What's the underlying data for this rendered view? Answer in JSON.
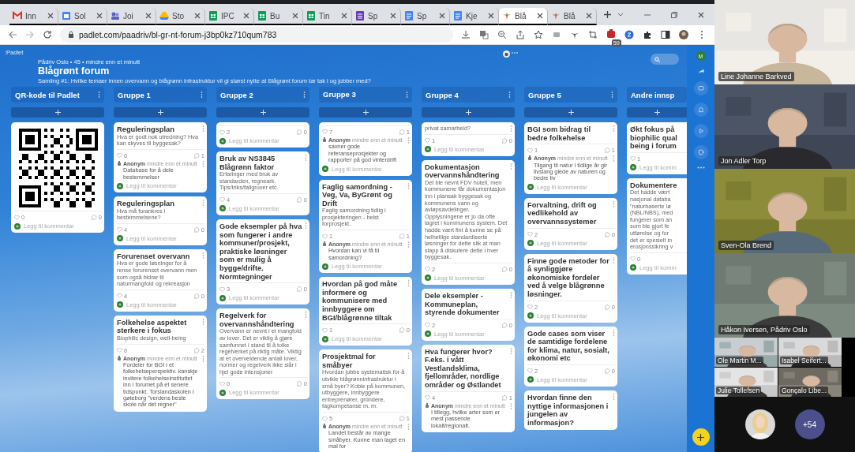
{
  "browser": {
    "tabs": [
      {
        "label": "Inn",
        "kind": "mail",
        "selected": false
      },
      {
        "label": "Sol",
        "kind": "calendar",
        "selected": false
      },
      {
        "label": "Joi",
        "kind": "teams",
        "selected": false
      },
      {
        "label": "Sto",
        "kind": "drive",
        "selected": false
      },
      {
        "label": "IPC",
        "kind": "sheet",
        "selected": false
      },
      {
        "label": "Bu",
        "kind": "sheet",
        "selected": false
      },
      {
        "label": "Tin",
        "kind": "sheet",
        "selected": false
      },
      {
        "label": "Sp",
        "kind": "form",
        "selected": false
      },
      {
        "label": "Sp",
        "kind": "doc",
        "selected": false
      },
      {
        "label": "Kje",
        "kind": "doc",
        "selected": false
      },
      {
        "label": "Blå",
        "kind": "padlet",
        "selected": true
      },
      {
        "label": "Blå",
        "kind": "padlet",
        "selected": false
      }
    ],
    "url": "padlet.com/paadriv/bl-gr-nt-forum-j3bp0kz710qum783",
    "extension_badge": "59"
  },
  "padlet": {
    "brand": ":Padlet",
    "meta": "Pådriv Oslo • 45 • mindre enn et minutt",
    "title": "Blågrønt forum",
    "subtitle": "Samling #1: Hvilke temaer innen overvann og blågrønn infrastruktur vil gi størst nytte at Blågrønt forum tar tak i og jobber med?",
    "user_initial": "M",
    "columns": [
      {
        "title": "QR-kode til Padlet",
        "cards": [
          {
            "kind": "qr",
            "likes": "0",
            "comments": "0",
            "placeholder": "Legg til kommentar"
          }
        ]
      },
      {
        "title": "Gruppe 1",
        "cards": [
          {
            "kind": "post",
            "title": "Reguleringsplan",
            "body": "Hva er godt nok utredning? Hva kan skyves til byggesak?",
            "likes": "6",
            "comments": "1",
            "comment": {
              "author": "Anonym",
              "time": "mindre enn et minutt",
              "text": "Database for å dele bestemmelser"
            },
            "placeholder": "Legg til kommentar"
          },
          {
            "kind": "post",
            "title": "Reguleringsplan",
            "body": "Hva må forankres i bestemmelsene?",
            "likes": "4",
            "comments": "0",
            "placeholder": "Legg til kommentar"
          },
          {
            "kind": "post",
            "title": "Forurenset overvann",
            "body": "Hva er gode løsninger for å rense forurenset overvann men som også bidrar til naturmangfold og rekreasjon",
            "likes": "4",
            "comments": "0",
            "placeholder": "Legg til kommentar"
          },
          {
            "kind": "post",
            "title": "Folkehelse aspektet sterkere i fokus",
            "body": "Biophilic design, well-being",
            "likes": "6",
            "comments": "2",
            "comment": {
              "author": "Anonym",
              "time": "mindre enn et minutt",
              "text": "Fordeler for BGI i et folkehelseperspektiv. kanskje invitere folkehelseinstituttet inn i forumet på et senere tidspunkt. Torslandaskolen i gøteborg \"verdens beste skole når det regner\""
            }
          }
        ]
      },
      {
        "title": "Gruppe 2",
        "cards": [
          {
            "kind": "post",
            "likes": "2",
            "comments": "0",
            "placeholder": "Legg til kommentar"
          },
          {
            "kind": "post",
            "title": "Bruk av NS3845 Blågrønn faktor",
            "body": "Erfaringer med bruk av standarden, regneark. Tips/triks/fallgruver etc.",
            "likes": "4",
            "comments": "0",
            "placeholder": "Legg til kommentar"
          },
          {
            "kind": "post",
            "title": "Gode eksempler på hva som fungerer i andre kommuner/prosjekt, praktiske løsninger som er mulig å bygge/drifte. Normtegninger",
            "likes": "3",
            "comments": "0",
            "placeholder": "Legg til kommentar"
          },
          {
            "kind": "post",
            "title": "Regelverk for overvannshåndtering",
            "body": "Overvann er nevnt i et mangfold av lover. Det er viktig å gjøre samfunnet i stand til å tolke regelverket på riktig måte. Viktig at et overveldende antall lover, normer og regelverk ikke slår i hjel gode intensjoner",
            "likes": "0",
            "comments": "0",
            "placeholder": "Legg til kommentar"
          }
        ]
      },
      {
        "title": "Gruppe 3",
        "cards": [
          {
            "kind": "post",
            "likes": "7",
            "comments": "1",
            "comment": {
              "author": "Anonym",
              "time": "mindre enn et minutt",
              "text": "savner gode referanseprosjekter og rapporter på god vinterdrift"
            },
            "placeholder": "Legg til kommentar"
          },
          {
            "kind": "post",
            "title": "Faglig samordning - Veg, Va, ByGrønt og Drift",
            "body": "Faglig samordning tidlig i prosjekteringen - helst forprosjekt.",
            "likes": "1",
            "comments": "1",
            "comment": {
              "author": "Anonym",
              "time": "mindre enn et minutt",
              "text": "Hvordan kan vi få til samordning?"
            },
            "placeholder": "Legg til kommentar"
          },
          {
            "kind": "post",
            "title": "Hvordan på god måte informere og kommunisere med innbyggere om BGI/blågrønne tiltak",
            "likes": "1",
            "comments": "0",
            "placeholder": "Legg til kommentar"
          },
          {
            "kind": "post",
            "title": "Prosjektmal for småbyer",
            "body": "Hvordan jobbe systematisk for å utvikle blågrønninfrastruktur i små byer? Koble på kommunen, utbyggere, innbyggere entreprenører, gründere, fagkompetanse m. m.",
            "likes": "5",
            "comments": "1",
            "comment": {
              "author": "Anonym",
              "time": "mindre enn et minutt",
              "text": "Landet består av mange småbyer. Kunne man laget en mal for"
            }
          }
        ]
      },
      {
        "title": "Gruppe 4",
        "cards": [
          {
            "kind": "post",
            "body": "privat samarbeid?",
            "likes": "1",
            "comments": "0",
            "placeholder": "Legg til kommentar"
          },
          {
            "kind": "post",
            "title": "Dokumentasjon overvannshåndtering",
            "body": "Det ble nevnt FDV hotell, men kommunene får dokumentasjon inn i plansak byggesak og kommunens vann og avløpsavdelinger. Opplysningene er jo da ofte lagret i kommunens system. Det hadde vært fint å kunne se på helhetlige standardiserte løsninger for dette slik at man slapp å diskutere dette i hver byggesak.",
            "likes": "2",
            "comments": "0",
            "placeholder": "Legg til kommentar"
          },
          {
            "kind": "post",
            "title": "Dele eksempler - Kommuneplan, styrende dokumenter",
            "likes": "2",
            "comments": "0",
            "placeholder": "Legg til kommentar"
          },
          {
            "kind": "post",
            "title": "Hva fungerer hvor? F.eks. i vått Vestlandsklima, fjellområder, nordlige områder og Østlandet",
            "likes": "4",
            "comments": "1",
            "comment": {
              "author": "Anonym",
              "time": "mindre enn et minutt",
              "text": "I tillegg, hvilke arter som er mest passende lokalt/regionalt."
            }
          }
        ]
      },
      {
        "title": "Gruppe 5",
        "cards": [
          {
            "kind": "post",
            "title": "BGI som bidrag til bedre folkehelse",
            "likes": "1",
            "comments": "1",
            "comment": {
              "author": "Anonym",
              "time": "mindre enn et minutt",
              "text": "Tilgang til natur i tidlige år gir livslang glede av naturen og bedre liv"
            },
            "placeholder": "Legg til kommentar"
          },
          {
            "kind": "post",
            "title": "Forvaltning, drift og vedlikehold av overvannssystemer",
            "likes": "2",
            "comments": "0",
            "placeholder": "Legg til kommentar"
          },
          {
            "kind": "post",
            "title": "Finne gode metoder for å synliggjøre økonomiske fordeler ved å velge blågrønne løsninger.",
            "likes": "2",
            "comments": "0",
            "placeholder": "Legg til kommentar"
          },
          {
            "kind": "post",
            "title": "Gode cases som viser de samtidige fordelene for klima, natur, sosialt, økonomi etc",
            "likes": "2",
            "comments": "0",
            "placeholder": "Legg til kommentar"
          },
          {
            "kind": "post",
            "title": "Hvordan finne den nyttige informasjonen i jungelen av informasjon?"
          }
        ]
      },
      {
        "title": "Andre innsp",
        "cards": [
          {
            "kind": "post",
            "title": "Økt fokus på\nbiophilic qual\nbeing i forum",
            "likes": "1",
            "placeholder": "Legg til komm"
          },
          {
            "kind": "post",
            "title": "Dokumentere",
            "body": "Det hadde vært\nnasjonal databa\n\"naturbaserte lø\n(NBL/NBS), med\nfungerer som an\nsom ble gjort fe\nutførelse og for\ndet er spesielt in\nerosjonssikring v",
            "likes": "0",
            "placeholder": "Legg til komm"
          }
        ]
      }
    ]
  },
  "video": {
    "tiles": [
      {
        "name": "Line Johanne Barkved",
        "kind": "large"
      },
      {
        "name": "Jon Adler Torp",
        "kind": "large"
      },
      {
        "name": "Sven-Ola Brend",
        "kind": "large"
      },
      {
        "name": "Håkon Iversen, Pådriv Oslo",
        "kind": "large"
      },
      {
        "name": "Ole Martin M...",
        "kind": "small"
      },
      {
        "name": "Isabel Seifert...",
        "kind": "small"
      },
      {
        "name": "Julie Tollefsen",
        "kind": "small"
      },
      {
        "name": "Gonçalo Libe...",
        "kind": "small"
      }
    ],
    "more_count": "+54"
  }
}
